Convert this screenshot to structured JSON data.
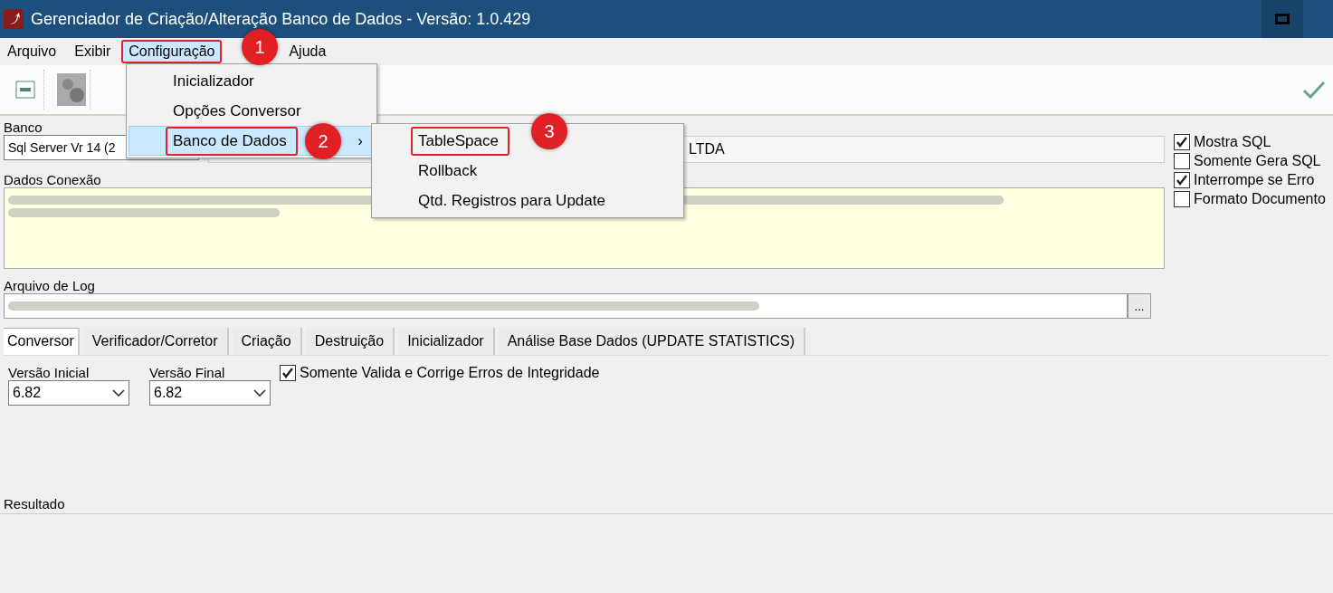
{
  "window": {
    "title": "Gerenciador de Criação/Alteração Banco de Dados - Versão: 1.0.429"
  },
  "menu_bar": [
    {
      "label": "Arquivo",
      "selected": false,
      "highlighted": false
    },
    {
      "label": "Exibir",
      "selected": false,
      "highlighted": false
    },
    {
      "label": "Configuração",
      "selected": true,
      "highlighted": true
    },
    {
      "label": "Ajuda",
      "selected": false,
      "highlighted": false
    }
  ],
  "dropdown": [
    {
      "label": "Inicializador",
      "selected": false,
      "highlighted": false
    },
    {
      "label": "Opções Conversor",
      "selected": false,
      "highlighted": false
    },
    {
      "label": "Banco de Dados",
      "selected": true,
      "highlighted": true,
      "arrow": "›"
    }
  ],
  "submenu": [
    {
      "label": "TableSpace",
      "highlighted": true
    },
    {
      "label": "Rollback",
      "highlighted": false
    },
    {
      "label": "Qtd. Registros para Update",
      "highlighted": false
    }
  ],
  "callouts": [
    {
      "number": "1"
    },
    {
      "number": "2"
    },
    {
      "number": "3"
    }
  ],
  "banco": {
    "label": "Banco",
    "value": "Sql Server Vr 14 (2",
    "server_value": "LTDA"
  },
  "dados_conexao": {
    "label": "Dados Conexão"
  },
  "arquivo_log": {
    "label": "Arquivo de Log",
    "browse": "..."
  },
  "options": [
    {
      "label": "Mostra SQL",
      "checked": true
    },
    {
      "label": "Somente Gera SQL",
      "checked": false
    },
    {
      "label": "Interrompe se Erro",
      "checked": true
    },
    {
      "label": "Formato Documento",
      "checked": false
    }
  ],
  "tabs": [
    {
      "label": "Conversor",
      "selected": true
    },
    {
      "label": "Verificador/Corretor",
      "selected": false
    },
    {
      "label": "Criação",
      "selected": false
    },
    {
      "label": "Destruição",
      "selected": false
    },
    {
      "label": "Inicializador",
      "selected": false
    },
    {
      "label": "Análise Base Dados (UPDATE STATISTICS)",
      "selected": false
    }
  ],
  "conversor": {
    "versao_inicial": {
      "label": "Versão Inicial",
      "value": "6.82"
    },
    "versao_final": {
      "label": "Versão Final",
      "value": "6.82"
    },
    "somente_valida": {
      "label": "Somente Valida e Corrige Erros de Integridade",
      "checked": true
    }
  },
  "resultado": {
    "label": "Resultado"
  }
}
